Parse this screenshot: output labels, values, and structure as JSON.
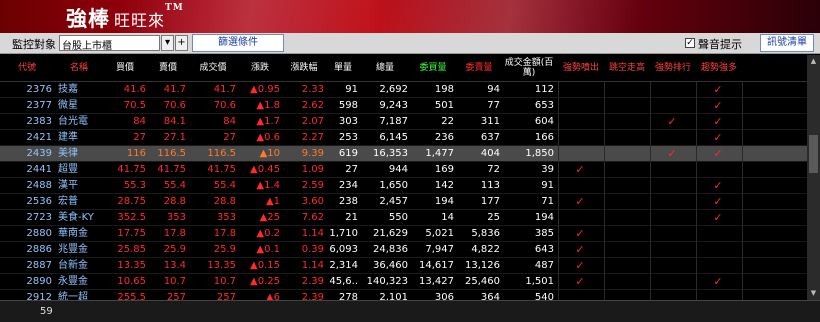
{
  "app": {
    "brand": "強棒",
    "subtitle": "旺旺來",
    "trademark": "TM"
  },
  "toolbar": {
    "monitor_label": "監控對象",
    "market_value": "台股上市櫃",
    "filter_button": "篩選條件",
    "sound_checkbox_checked": true,
    "sound_label": "聲音提示",
    "clear_button": "訊號清單"
  },
  "table": {
    "headers": [
      "代號",
      "名稱",
      "買價",
      "賣價",
      "成交價",
      "漲跌",
      "漲跌幅",
      "單量",
      "總量",
      "委買量",
      "委賣量",
      "成交金額(百萬)",
      "強勢噴出",
      "跳空走高",
      "強勢排行",
      "趨勢強多"
    ],
    "rows": [
      {
        "code": "2376",
        "name": "技嘉",
        "bid": "41.6",
        "ask": "41.7",
        "price": "41.7",
        "chg": "▲0.95",
        "pct": "2.33",
        "vol": "91",
        "total": "2,692",
        "bidq": "198",
        "askq": "94",
        "amt": "112",
        "s1": "",
        "s2": "",
        "s3": "",
        "s4": "✓"
      },
      {
        "code": "2377",
        "name": "微星",
        "bid": "70.5",
        "ask": "70.6",
        "price": "70.6",
        "chg": "▲1.8",
        "pct": "2.62",
        "vol": "598",
        "total": "9,243",
        "bidq": "501",
        "askq": "77",
        "amt": "653",
        "s1": "",
        "s2": "",
        "s3": "",
        "s4": "✓"
      },
      {
        "code": "2383",
        "name": "台光電",
        "bid": "84",
        "ask": "84.1",
        "price": "84",
        "chg": "▲1.7",
        "pct": "2.07",
        "vol": "303",
        "total": "7,187",
        "bidq": "22",
        "askq": "311",
        "amt": "604",
        "s1": "",
        "s2": "",
        "s3": "✓",
        "s4": "✓"
      },
      {
        "code": "2421",
        "name": "建準",
        "bid": "27",
        "ask": "27.1",
        "price": "27",
        "chg": "▲0.6",
        "pct": "2.27",
        "vol": "253",
        "total": "6,145",
        "bidq": "236",
        "askq": "637",
        "amt": "166",
        "s1": "",
        "s2": "",
        "s3": "",
        "s4": "✓"
      },
      {
        "code": "2439",
        "name": "美律",
        "bid": "116",
        "ask": "116.5",
        "price": "116.5",
        "chg": "▲10",
        "pct": "9.39",
        "vol": "619",
        "total": "16,353",
        "bidq": "1,477",
        "askq": "404",
        "amt": "1,850",
        "s1": "",
        "s2": "",
        "s3": "✓",
        "s4": "✓",
        "sel": true
      },
      {
        "code": "2441",
        "name": "超豐",
        "bid": "41.75",
        "ask": "41.75",
        "price": "41.75",
        "chg": "▲0.45",
        "pct": "1.09",
        "vol": "27",
        "total": "944",
        "bidq": "169",
        "askq": "72",
        "amt": "39",
        "s1": "✓",
        "s2": "",
        "s3": "",
        "s4": ""
      },
      {
        "code": "2488",
        "name": "漢平",
        "bid": "55.3",
        "ask": "55.4",
        "price": "55.4",
        "chg": "▲1.4",
        "pct": "2.59",
        "vol": "234",
        "total": "1,650",
        "bidq": "142",
        "askq": "113",
        "amt": "91",
        "s1": "",
        "s2": "",
        "s3": "",
        "s4": "✓"
      },
      {
        "code": "2536",
        "name": "宏普",
        "bid": "28.75",
        "ask": "28.8",
        "price": "28.8",
        "chg": "▲1",
        "pct": "3.60",
        "vol": "238",
        "total": "2,457",
        "bidq": "194",
        "askq": "177",
        "amt": "71",
        "s1": "✓",
        "s2": "",
        "s3": "",
        "s4": "✓"
      },
      {
        "code": "2723",
        "name": "美食-KY",
        "bid": "352.5",
        "ask": "353",
        "price": "353",
        "chg": "▲25",
        "pct": "7.62",
        "vol": "21",
        "total": "550",
        "bidq": "14",
        "askq": "25",
        "amt": "194",
        "s1": "",
        "s2": "",
        "s3": "",
        "s4": "✓"
      },
      {
        "code": "2880",
        "name": "華南金",
        "bid": "17.75",
        "ask": "17.8",
        "price": "17.8",
        "chg": "▲0.2",
        "pct": "1.14",
        "vol": "1,710",
        "total": "21,629",
        "bidq": "5,021",
        "askq": "5,836",
        "amt": "385",
        "s1": "✓",
        "s2": "",
        "s3": "",
        "s4": ""
      },
      {
        "code": "2886",
        "name": "兆豐金",
        "bid": "25.85",
        "ask": "25.9",
        "price": "25.9",
        "chg": "▲0.1",
        "pct": "0.39",
        "vol": "6,093",
        "total": "24,836",
        "bidq": "7,947",
        "askq": "4,822",
        "amt": "643",
        "s1": "✓",
        "s2": "",
        "s3": "",
        "s4": ""
      },
      {
        "code": "2887",
        "name": "台新金",
        "bid": "13.35",
        "ask": "13.4",
        "price": "13.35",
        "chg": "▲0.15",
        "pct": "1.14",
        "vol": "2,314",
        "total": "36,460",
        "bidq": "14,617",
        "askq": "13,126",
        "amt": "487",
        "s1": "✓",
        "s2": "",
        "s3": "",
        "s4": ""
      },
      {
        "code": "2890",
        "name": "永豐金",
        "bid": "10.65",
        "ask": "10.7",
        "price": "10.7",
        "chg": "▲0.25",
        "pct": "2.39",
        "vol": "45,6..",
        "total": "140,323",
        "bidq": "13,427",
        "askq": "25,460",
        "amt": "1,501",
        "s1": "✓",
        "s2": "",
        "s3": "",
        "s4": "✓"
      },
      {
        "code": "2912",
        "name": "統一超",
        "bid": "255.5",
        "ask": "257",
        "price": "257",
        "chg": "▲6",
        "pct": "2.39",
        "vol": "278",
        "total": "2,101",
        "bidq": "306",
        "askq": "364",
        "amt": "540",
        "s1": "",
        "s2": "",
        "s3": "",
        "s4": ""
      }
    ]
  },
  "status": {
    "count": "59"
  },
  "colors": {
    "up": "#ff2a2a",
    "code": "#8fc4ff",
    "bidq": "#33ff33",
    "askq": "#ff2a2a"
  }
}
